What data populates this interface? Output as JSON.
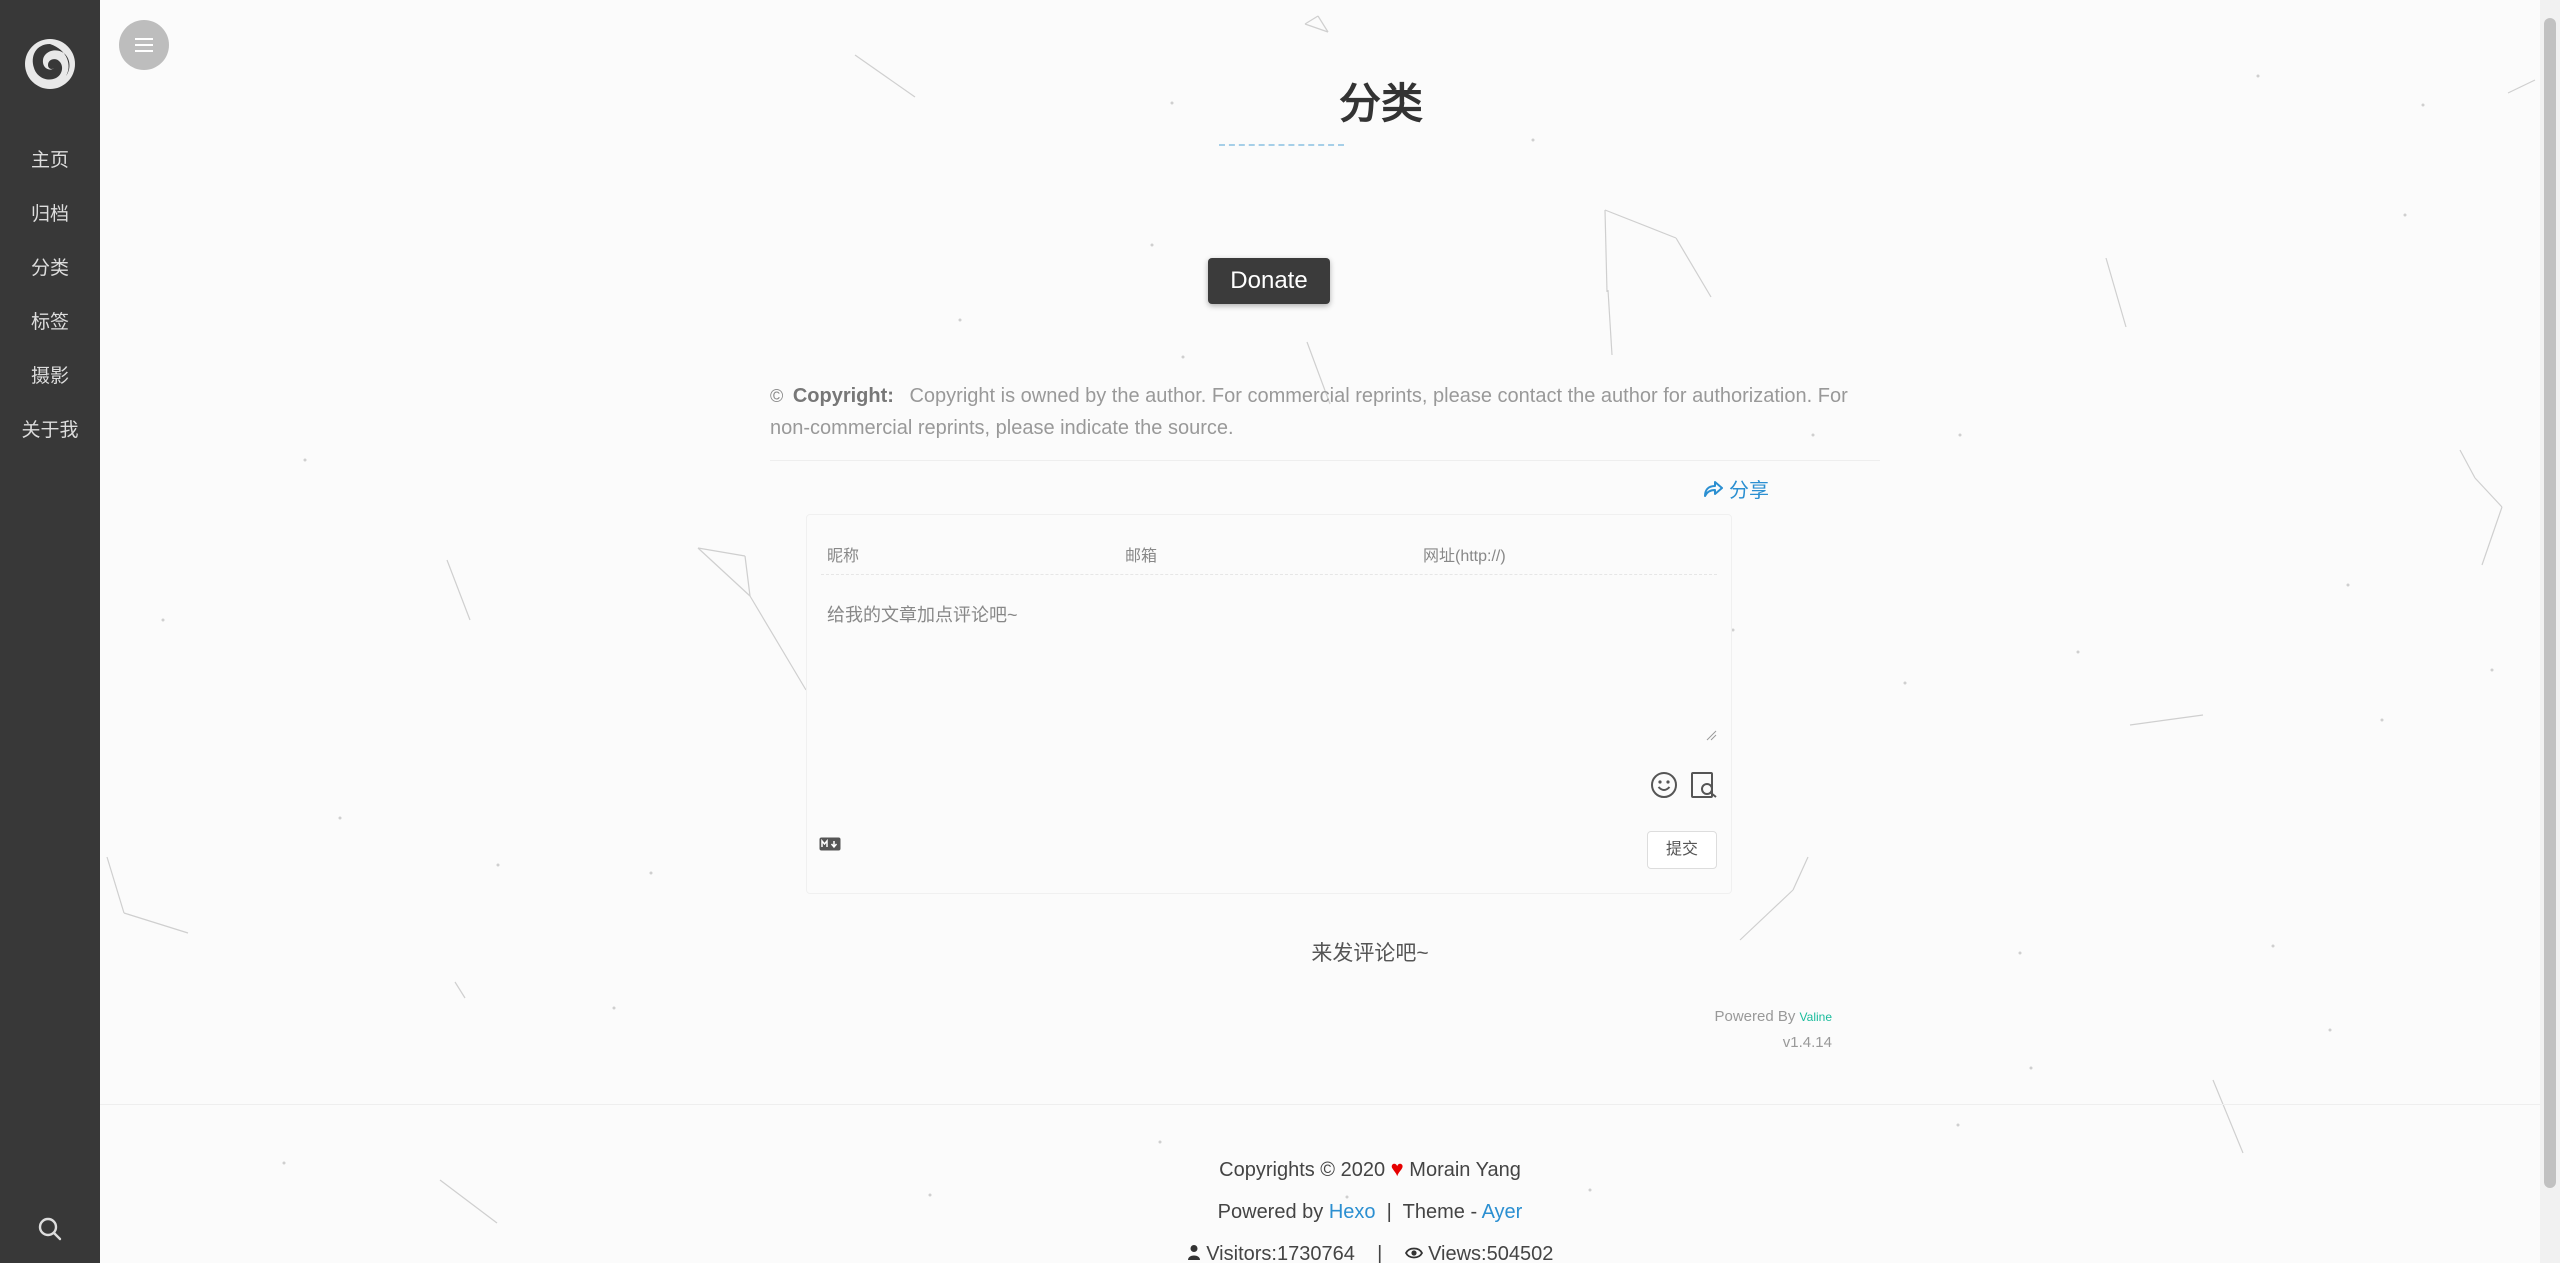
{
  "sidebar": {
    "items": [
      {
        "label": "主页",
        "name": "sidebar-item-home"
      },
      {
        "label": "归档",
        "name": "sidebar-item-archives"
      },
      {
        "label": "分类",
        "name": "sidebar-item-categories"
      },
      {
        "label": "标签",
        "name": "sidebar-item-tags"
      },
      {
        "label": "摄影",
        "name": "sidebar-item-photography"
      },
      {
        "label": "关于我",
        "name": "sidebar-item-about"
      }
    ]
  },
  "page": {
    "title": "分类",
    "donate_label": "Donate",
    "copyright_label": "Copyright:",
    "copyright_text": "Copyright is owned by the author. For commercial reprints, please contact the author for authorization. For non-commercial reprints, please indicate the source.",
    "share_label": "分享"
  },
  "comment": {
    "nick_placeholder": "昵称",
    "mail_placeholder": "邮箱",
    "link_placeholder": "网址(http://)",
    "text_placeholder": "给我的文章加点评论吧~",
    "submit_label": "提交",
    "empty_text": "来发评论吧~",
    "powered_by": "Powered By",
    "valine": "Valine",
    "version": "v1.4.14"
  },
  "footer": {
    "copyright": "Copyrights © 2020",
    "author": "Morain Yang",
    "powered_by": "Powered by",
    "hexo": "Hexo",
    "separator": "|",
    "theme": "Theme -",
    "ayer": "Ayer",
    "visitors": "Visitors:1730764",
    "views": "Views:504502"
  },
  "colors": {
    "sidebar_bg": "#383838",
    "link": "#2b8fd1",
    "heart": "#e60000",
    "valine": "#1abc9c"
  }
}
